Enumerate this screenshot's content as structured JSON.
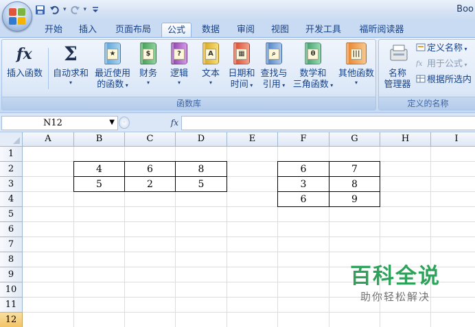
{
  "app": {
    "title": "Boo",
    "quick_access": [
      "save-icon",
      "undo-icon",
      "redo-icon",
      "customize-icon"
    ]
  },
  "tabs": [
    {
      "label": "开始",
      "active": false
    },
    {
      "label": "插入",
      "active": false
    },
    {
      "label": "页面布局",
      "active": false
    },
    {
      "label": "公式",
      "active": true
    },
    {
      "label": "数据",
      "active": false
    },
    {
      "label": "审阅",
      "active": false
    },
    {
      "label": "视图",
      "active": false
    },
    {
      "label": "开发工具",
      "active": false
    },
    {
      "label": "福昕阅读器",
      "active": false
    }
  ],
  "ribbon": {
    "function_library": {
      "caption": "函数库",
      "insert_function": {
        "icon": "fx-icon",
        "label": "插入函数"
      },
      "autosum": {
        "icon": "sigma-icon",
        "label": "自动求和"
      },
      "recent": {
        "icon": "star-book-icon",
        "line1": "最近使用",
        "line2": "的函数"
      },
      "financial": {
        "icon": "money-book-icon",
        "label": "财务"
      },
      "logical": {
        "icon": "question-book-icon",
        "label": "逻辑"
      },
      "text": {
        "icon": "text-book-icon",
        "label": "文本"
      },
      "datetime": {
        "icon": "calendar-book-icon",
        "line1": "日期和",
        "line2": "时间"
      },
      "lookup": {
        "icon": "magnifier-book-icon",
        "line1": "查找与",
        "line2": "引用"
      },
      "math": {
        "icon": "theta-book-icon",
        "line1": "数学和",
        "line2": "三角函数"
      },
      "more": {
        "icon": "more-books-icon",
        "label": "其他函数"
      }
    },
    "defined_names": {
      "caption": "定义的名称",
      "name_manager": {
        "icon": "name-manager-icon",
        "line1": "名称",
        "line2": "管理器"
      },
      "define_name": "定义名称",
      "use_in_formula": "用于公式",
      "create_from_selection": "根据所选内"
    }
  },
  "formula_bar": {
    "name_box": "N12",
    "fx_label": "fx",
    "formula": ""
  },
  "sheet": {
    "columns": [
      "A",
      "B",
      "C",
      "D",
      "E",
      "F",
      "G",
      "H",
      "I"
    ],
    "rows": [
      "1",
      "2",
      "3",
      "4",
      "5",
      "6",
      "7",
      "8",
      "9",
      "10",
      "11",
      "12"
    ],
    "selected_row": "12",
    "cells": {
      "B2": "4",
      "C2": "6",
      "D2": "8",
      "B3": "5",
      "C3": "2",
      "D3": "5",
      "F2": "6",
      "G2": "7",
      "F3": "3",
      "G3": "8",
      "F4": "6",
      "G4": "9"
    }
  },
  "watermark": {
    "title": "百科全说",
    "subtitle": "助你轻松解决"
  },
  "colors": {
    "accent": "#15428b",
    "selected_row": "#f3c366",
    "watermark_green": "#2ea15a"
  }
}
